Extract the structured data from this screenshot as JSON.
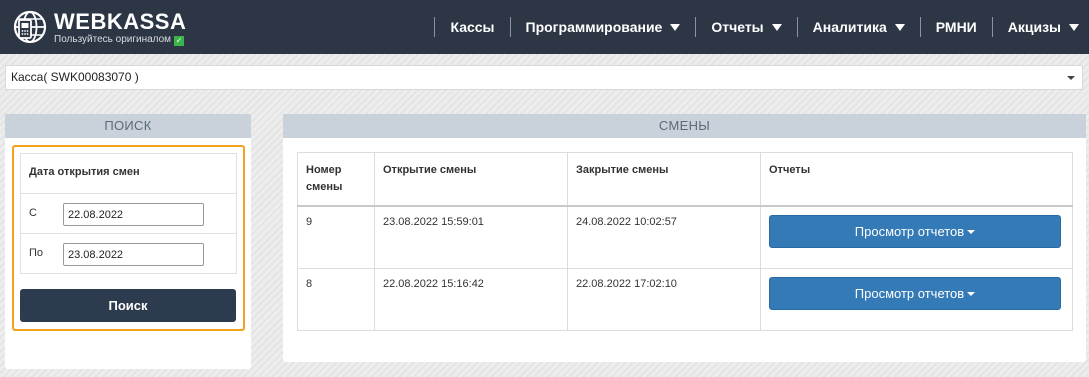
{
  "header": {
    "brand": "WEBKASSA",
    "tagline": "Пользуйтесь оригиналом",
    "nav": [
      {
        "label": "Кассы",
        "dropdown": false
      },
      {
        "label": "Программирование",
        "dropdown": true
      },
      {
        "label": "Отчеты",
        "dropdown": true
      },
      {
        "label": "Аналитика",
        "dropdown": true
      },
      {
        "label": "РМНИ",
        "dropdown": false
      },
      {
        "label": "Акцизы",
        "dropdown": true
      }
    ]
  },
  "kassa_select": {
    "value": "Касса( SWK00083070 )"
  },
  "search": {
    "title": "ПОИСК",
    "filter_title": "Дата открытия смен",
    "from_label": "С",
    "from_value": "22.08.2022",
    "to_label": "По",
    "to_value": "23.08.2022",
    "button": "Поиск"
  },
  "shifts": {
    "title": "СМЕНЫ",
    "columns": [
      "Номер смены",
      "Открытие смены",
      "Закрытие смены",
      "Отчеты"
    ],
    "rows": [
      {
        "number": "9",
        "opened": "23.08.2022 15:59:01",
        "closed": "24.08.2022 10:02:57",
        "action": "Просмотр отчетов"
      },
      {
        "number": "8",
        "opened": "22.08.2022 15:16:42",
        "closed": "22.08.2022 17:02:10",
        "action": "Просмотр отчетов"
      }
    ]
  },
  "colors": {
    "header_bg": "#2d3645",
    "panel_head_bg": "#c9d2da",
    "highlight": "#f4a21c",
    "primary_button": "#337ab7",
    "search_button": "#2d3b4e",
    "check": "#3ab54a"
  },
  "icons": [
    "webkassa-logo-icon",
    "check-icon",
    "caret-down-icon"
  ]
}
